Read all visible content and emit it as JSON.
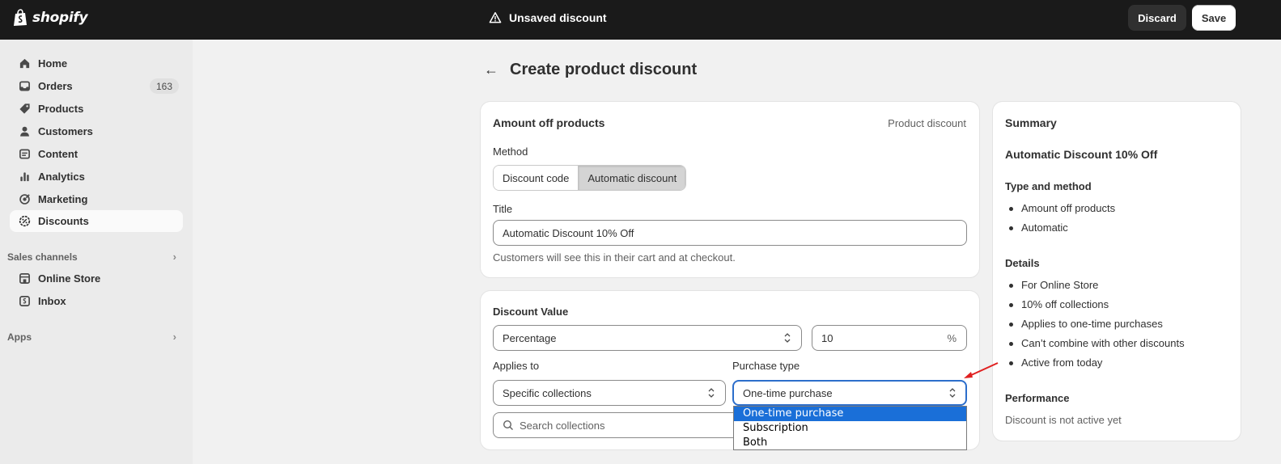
{
  "topbar": {
    "brand": "shopify",
    "status": "Unsaved discount",
    "discard_label": "Discard",
    "save_label": "Save"
  },
  "sidebar": {
    "items": [
      {
        "label": "Home",
        "icon": "home-icon"
      },
      {
        "label": "Orders",
        "icon": "inbox-tray-icon",
        "badge": "163"
      },
      {
        "label": "Products",
        "icon": "tag-icon"
      },
      {
        "label": "Customers",
        "icon": "person-icon"
      },
      {
        "label": "Content",
        "icon": "image-icon"
      },
      {
        "label": "Analytics",
        "icon": "bar-chart-icon"
      },
      {
        "label": "Marketing",
        "icon": "target-icon"
      },
      {
        "label": "Discounts",
        "icon": "discount-badge-icon",
        "active": true
      }
    ],
    "sales_channels_label": "Sales channels",
    "channels": [
      {
        "label": "Online Store",
        "icon": "storefront-icon"
      },
      {
        "label": "Inbox",
        "icon": "chat-icon"
      }
    ],
    "apps_label": "Apps"
  },
  "page": {
    "title": "Create product discount"
  },
  "card1": {
    "heading": "Amount off products",
    "type_label": "Product discount",
    "method_label": "Method",
    "method_options": [
      "Discount code",
      "Automatic discount"
    ],
    "method_selected": "Automatic discount",
    "title_label": "Title",
    "title_value": "Automatic Discount 10% Off",
    "title_help": "Customers will see this in their cart and at checkout."
  },
  "card2": {
    "heading": "Discount Value",
    "value_type": "Percentage",
    "value_amount": "10",
    "value_suffix": "%",
    "applies_to_label": "Applies to",
    "applies_to_value": "Specific collections",
    "purchase_type_label": "Purchase type",
    "purchase_type_value": "One-time purchase",
    "search_placeholder": "Search collections",
    "purchase_type_options": [
      "One-time purchase",
      "Subscription",
      "Both"
    ]
  },
  "summary": {
    "heading": "Summary",
    "discount_title": "Automatic Discount 10% Off",
    "type_method_label": "Type and method",
    "type_method_items": [
      "Amount off products",
      "Automatic"
    ],
    "details_label": "Details",
    "details_items": [
      "For Online Store",
      "10% off collections",
      "Applies to one-time purchases",
      "Can’t combine with other discounts",
      "Active from today"
    ],
    "performance_label": "Performance",
    "performance_text": "Discount is not active yet"
  },
  "colors": {
    "topbar": "#1a1a1a",
    "focus": "#2c6ecb",
    "highlight": "#1a6fd8",
    "annotation_arrow": "#e02020"
  }
}
